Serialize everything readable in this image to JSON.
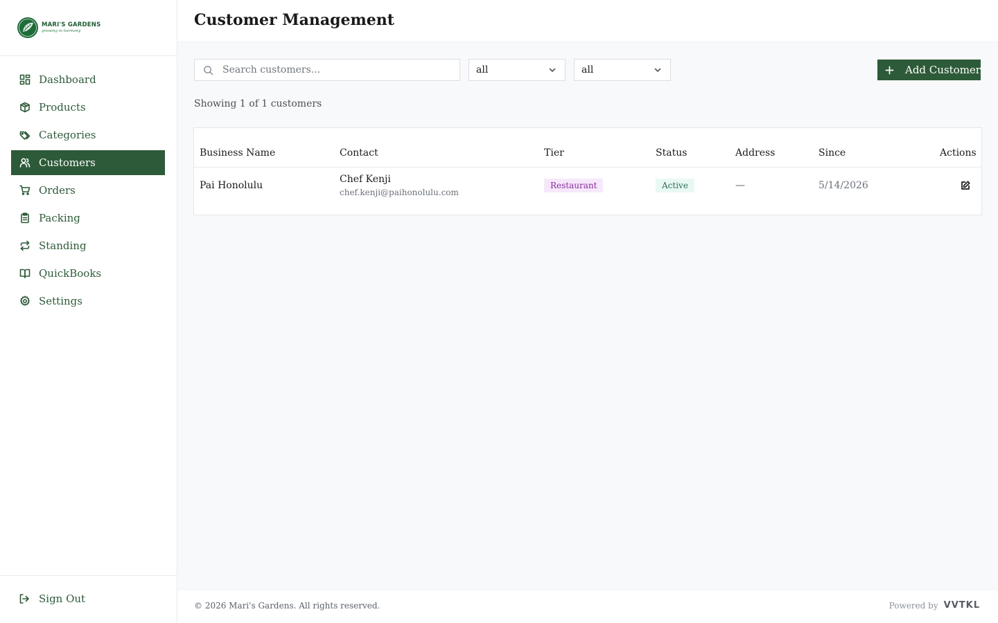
{
  "brand": {
    "name": "MARI'S GARDENS",
    "tagline": "growing in harmony"
  },
  "sidebar": {
    "items": [
      {
        "label": "Dashboard",
        "icon": "grid-icon",
        "active": false
      },
      {
        "label": "Products",
        "icon": "package-icon",
        "active": false
      },
      {
        "label": "Categories",
        "icon": "tags-icon",
        "active": false
      },
      {
        "label": "Customers",
        "icon": "users-icon",
        "active": true
      },
      {
        "label": "Orders",
        "icon": "cart-icon",
        "active": false
      },
      {
        "label": "Packing",
        "icon": "clipboard-icon",
        "active": false
      },
      {
        "label": "Standing",
        "icon": "repeat-icon",
        "active": false
      },
      {
        "label": "QuickBooks",
        "icon": "book-icon",
        "active": false
      },
      {
        "label": "Settings",
        "icon": "gear-icon",
        "active": false
      }
    ],
    "signout_label": "Sign Out"
  },
  "header": {
    "title": "Customer Management"
  },
  "toolbar": {
    "search_placeholder": "Search customers...",
    "tier_filter": "all",
    "status_filter": "all",
    "add_label": "Add Customer"
  },
  "count_text": "Showing 1 of 1 customers",
  "table": {
    "columns": [
      "Business Name",
      "Contact",
      "Tier",
      "Status",
      "Address",
      "Since",
      "Actions"
    ],
    "rows": [
      {
        "business_name": "Pai Honolulu",
        "contact_name": "Chef Kenji",
        "contact_email": "chef.kenji@paihonolulu.com",
        "tier": "Restaurant",
        "status": "Active",
        "address": "—",
        "since": "5/14/2026"
      }
    ]
  },
  "footer": {
    "copyright": "© 2026 Mari's Gardens. All rights reserved.",
    "powered_by": "Powered by",
    "vendor": "VVTKL"
  },
  "colors": {
    "brand_green": "#2d5a38",
    "tier_badge_bg": "#f6e8fa",
    "tier_badge_text": "#8a2a9e",
    "status_badge_bg": "#e9f8f4",
    "status_badge_text": "#2a6d52"
  }
}
